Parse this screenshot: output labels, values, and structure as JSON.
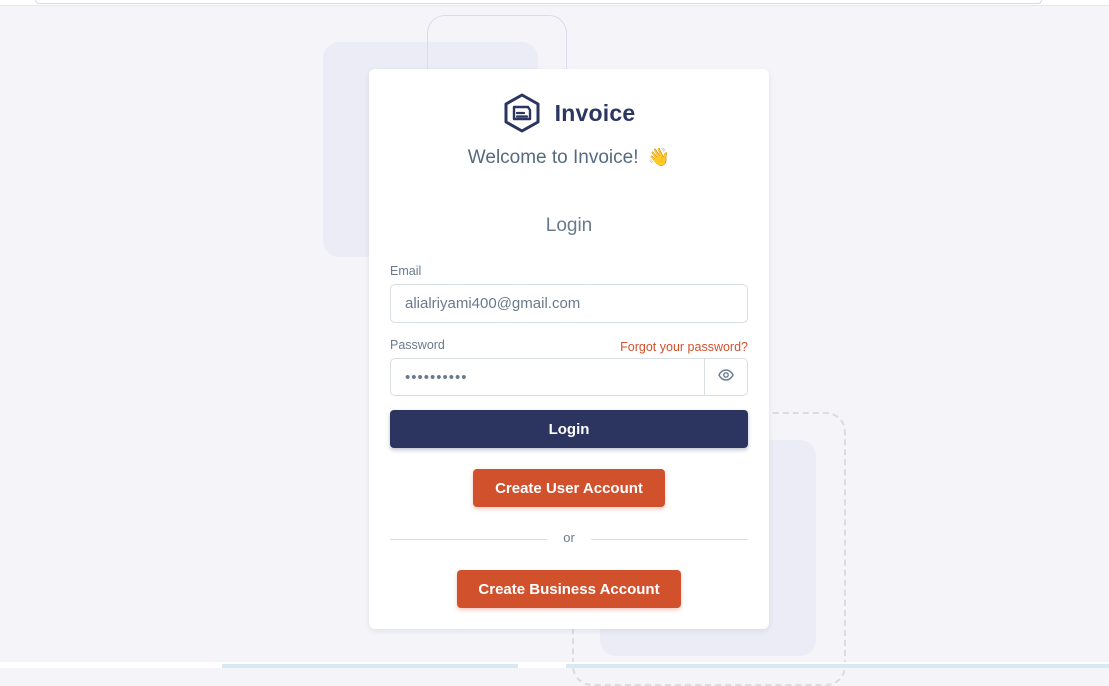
{
  "app": {
    "brand_name": "Invoice",
    "welcome": "Welcome to Invoice!",
    "welcome_emoji": "👋"
  },
  "login_form": {
    "heading": "Login",
    "email_label": "Email",
    "email_value": "alialriyami400@gmail.com",
    "password_label": "Password",
    "password_value": "••••••••••",
    "forgot_link": "Forgot your password?",
    "submit_label": "Login",
    "show_password_icon": "eye-icon"
  },
  "alternatives": {
    "create_user_label": "Create User Account",
    "divider_text": "or",
    "create_business_label": "Create Business Account"
  },
  "colors": {
    "primary": "#2b3560",
    "accent": "#d1512d",
    "background": "#f5f5f9",
    "text": "#697a8d"
  }
}
